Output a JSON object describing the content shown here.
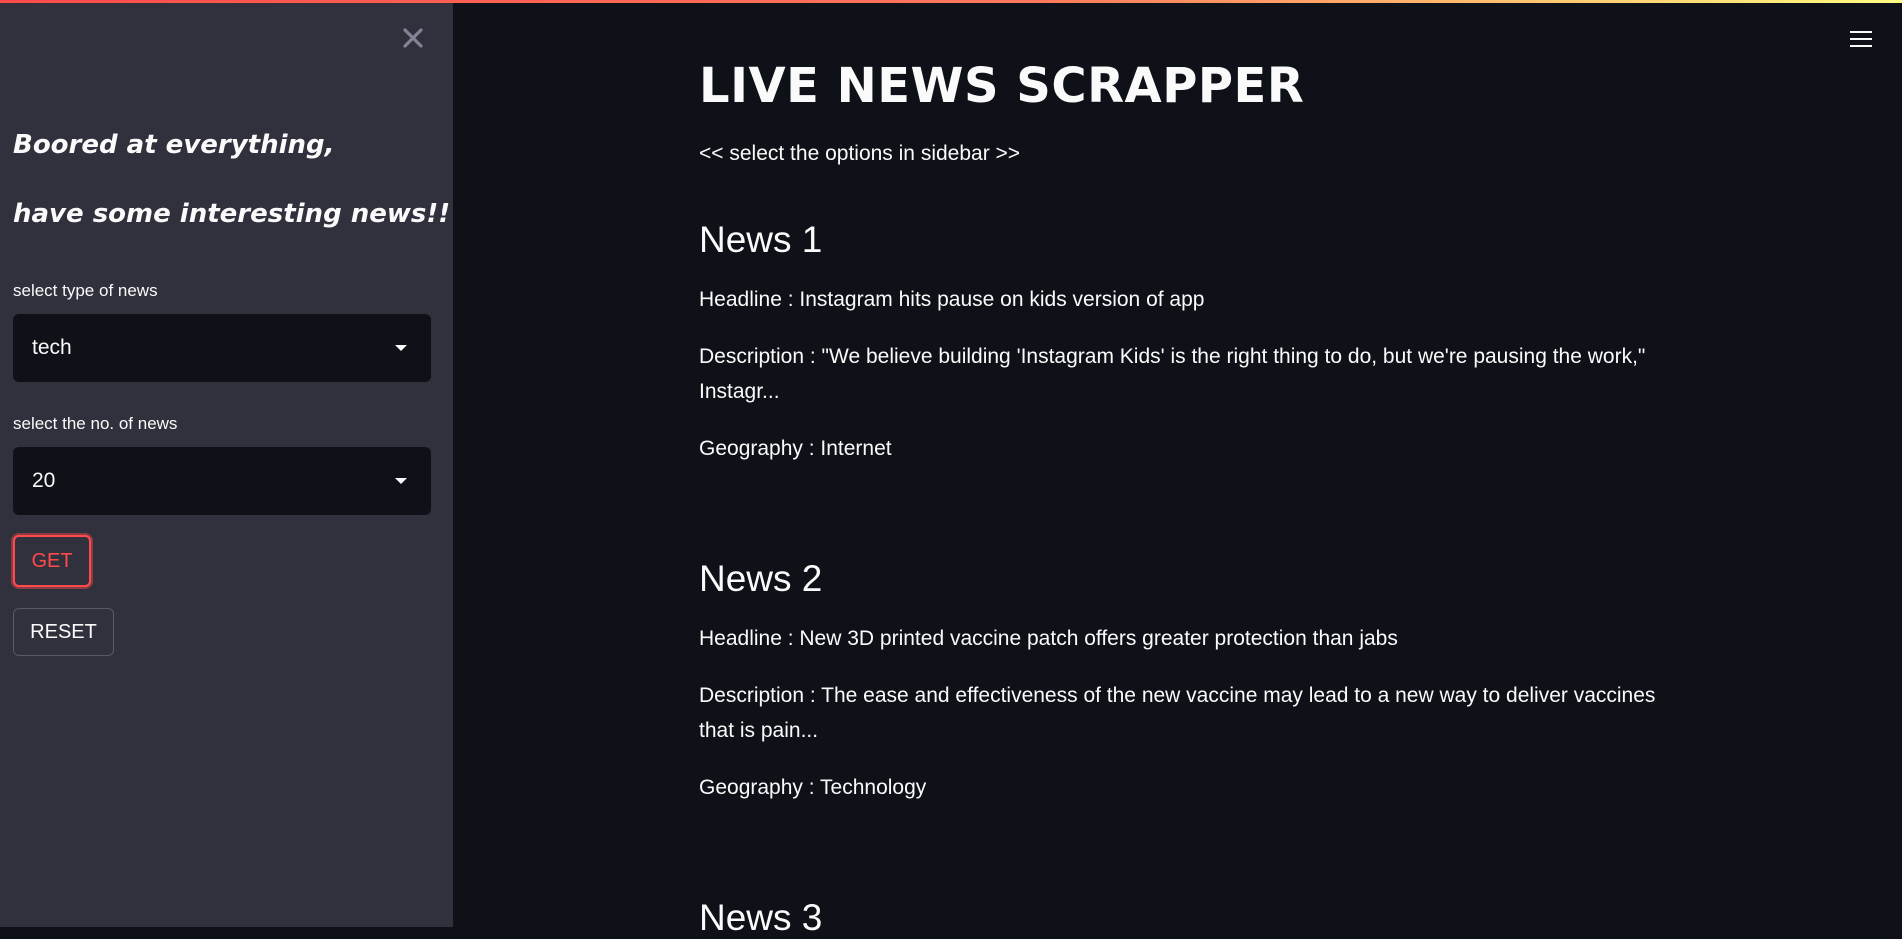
{
  "sidebar": {
    "close_icon": "close-icon",
    "tagline_line1": "Boored at everything,",
    "tagline_line2": "have some interesting news!!",
    "type_label": "select type of news",
    "type_value": "tech",
    "count_label": "select the no. of news",
    "count_value": "20",
    "get_label": "GET",
    "reset_label": "RESET"
  },
  "header": {
    "menu_icon": "hamburger-menu-icon",
    "accent_gradient": [
      "#ff4b4b",
      "#fffd80"
    ]
  },
  "main": {
    "title": "LIVE NEWS SCRAPPER",
    "subtitle": "<< select the options in sidebar >>",
    "news": [
      {
        "heading": "News 1",
        "headline": "Headline : Instagram hits pause on kids version of app",
        "description": "Description : \"We believe building 'Instagram Kids' is the right thing to do, but we're pausing the work,\" Instagr...",
        "geography": "Geography : Internet"
      },
      {
        "heading": "News 2",
        "headline": "Headline : New 3D printed vaccine patch offers greater protection than jabs",
        "description": "Description : The ease and effectiveness of the new vaccine may lead to a new way to deliver vaccines that is pain...",
        "geography": "Geography : Technology"
      },
      {
        "heading": "News 3"
      }
    ]
  },
  "colors": {
    "background": "#0e1117",
    "sidebar": "#30313c",
    "primary": "#ff4b4b",
    "text": "#fafafa"
  }
}
